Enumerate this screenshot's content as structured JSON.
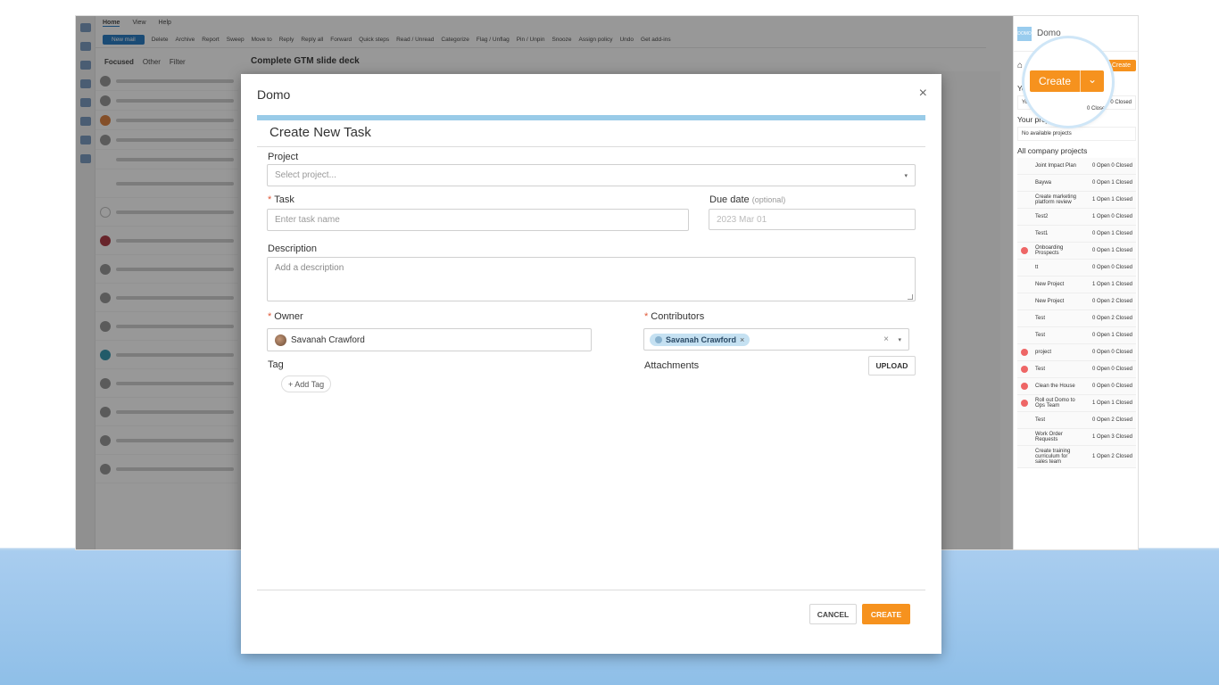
{
  "outlook": {
    "menu": [
      "Home",
      "View",
      "Help"
    ],
    "ribbon": [
      "New mail",
      "Delete",
      "Archive",
      "Report",
      "Sweep",
      "Move to",
      "Reply",
      "Reply all",
      "Forward",
      "Quick steps",
      "Read / Unread",
      "Categorize",
      "Flag / Unflag",
      "Pin / Unpin",
      "Snooze",
      "Assign policy",
      "Undo",
      "Get add-ins"
    ],
    "filter": {
      "focused": "Focused",
      "other": "Other",
      "filter": "Filter"
    },
    "subject": "Complete GTM slide deck"
  },
  "domo_panel": {
    "brand": "Domo",
    "create_label": "Create",
    "your_tasks_heading": "Your",
    "your_tasks_note": "Yo tasks",
    "your_tasks_status": "0 Closed",
    "your_projects_heading": "Your projects",
    "your_projects_empty": "No available projects",
    "company_heading": "All company projects",
    "projects": [
      {
        "name": "Joint Impact Plan",
        "status": "0 Open 0 Closed",
        "dot": false
      },
      {
        "name": "Baywa",
        "status": "0 Open 1 Closed",
        "dot": false
      },
      {
        "name": "Create marketing platform review",
        "status": "1 Open 1 Closed",
        "dot": false
      },
      {
        "name": "Test2",
        "status": "1 Open 0 Closed",
        "dot": false
      },
      {
        "name": "Test1",
        "status": "0 Open 1 Closed",
        "dot": false
      },
      {
        "name": "Onboarding Prospects",
        "status": "0 Open 1 Closed",
        "dot": true
      },
      {
        "name": "tt",
        "status": "0 Open 0 Closed",
        "dot": false
      },
      {
        "name": "New Project",
        "status": "1 Open 1 Closed",
        "dot": false
      },
      {
        "name": "New Project",
        "status": "0 Open 2 Closed",
        "dot": false
      },
      {
        "name": "Test",
        "status": "0 Open 2 Closed",
        "dot": false
      },
      {
        "name": "Test",
        "status": "0 Open 1 Closed",
        "dot": false
      },
      {
        "name": "project",
        "status": "0 Open 0 Closed",
        "dot": true
      },
      {
        "name": "Test",
        "status": "0 Open 0 Closed",
        "dot": true
      },
      {
        "name": "Clean the House",
        "status": "0 Open 0 Closed",
        "dot": true
      },
      {
        "name": "Roll out Domo to Ops Team",
        "status": "1 Open 1 Closed",
        "dot": true
      },
      {
        "name": "Test",
        "status": "0 Open 2 Closed",
        "dot": false
      },
      {
        "name": "Work Order Requests",
        "status": "1 Open 3 Closed",
        "dot": false
      },
      {
        "name": "Create training curriculum for sales team",
        "status": "1 Open 2 Closed",
        "dot": false
      }
    ]
  },
  "callout": {
    "create_label": "Create",
    "closed_note": "0 Closed"
  },
  "modal": {
    "title": "Domo",
    "heading": "Create New Task",
    "project_label": "Project",
    "project_placeholder": "Select project...",
    "task_label": "Task",
    "task_placeholder": "Enter task name",
    "due_label": "Due date",
    "due_optional": "(optional)",
    "due_placeholder": "2023 Mar 01",
    "description_label": "Description",
    "description_placeholder": "Add a description",
    "owner_label": "Owner",
    "owner_value": "Savanah Crawford",
    "contributors_label": "Contributors",
    "contributor_chip": "Savanah Crawford",
    "tag_label": "Tag",
    "add_tag": "+ Add Tag",
    "attachments_label": "Attachments",
    "upload": "UPLOAD",
    "cancel": "CANCEL",
    "create": "CREATE",
    "required_mark": "*",
    "close_glyph": "×",
    "clear_glyph": "×",
    "caret_glyph": "▾"
  }
}
